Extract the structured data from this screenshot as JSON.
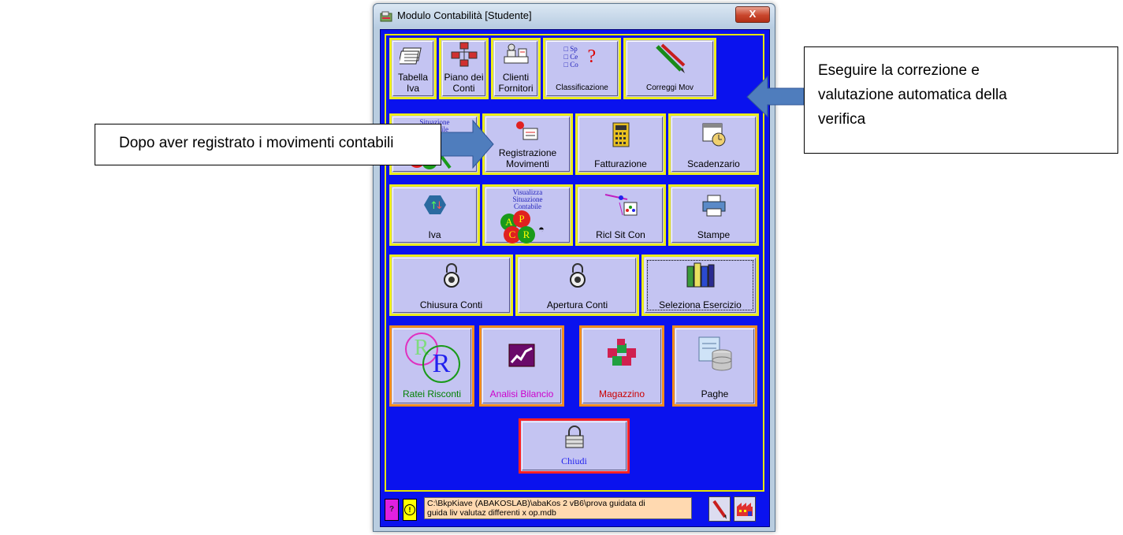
{
  "window": {
    "title": "Modulo Contabilità  [Studente]",
    "close_symbol": "X"
  },
  "row1": [
    {
      "label_lines": [
        "Tabella",
        "Iva"
      ],
      "icon": "ledger-icon"
    },
    {
      "label_lines": [
        "Piano dei",
        "Conti"
      ],
      "icon": "org-chart-icon"
    },
    {
      "label_lines": [
        "Clienti",
        "Fornitori"
      ],
      "icon": "person-desk-icon"
    },
    {
      "label_lines": [
        "Classificazione"
      ],
      "icon": "classification-icon",
      "icon_text": [
        "Sp",
        "Ce",
        "Co"
      ],
      "icon_mark": "?"
    },
    {
      "label_lines": [
        "Correggi Mov"
      ],
      "icon": "pencils-icon"
    }
  ],
  "row2": [
    {
      "label_lines": [
        ""
      ],
      "icon_text": [
        "Situazione",
        "Contabile"
      ],
      "icon": "account-situation-icon"
    },
    {
      "label_lines": [
        "Registrazione",
        "Movimenti"
      ],
      "icon": "registration-icon"
    },
    {
      "label_lines": [
        "Fatturazione"
      ],
      "icon": "calculator-icon"
    },
    {
      "label_lines": [
        "Scadenzario"
      ],
      "icon": "calendar-clock-icon"
    }
  ],
  "row3": [
    {
      "label_lines": [
        "Iva"
      ],
      "icon": "iva-arrows-icon"
    },
    {
      "label_lines": [
        ""
      ],
      "icon_text": [
        "Visualizza",
        "Situazione",
        "Contabile"
      ],
      "icon_letters": [
        "A",
        "P",
        "C",
        "R"
      ],
      "icon": "view-situation-icon"
    },
    {
      "label_lines": [
        "Ricl Sit Con"
      ],
      "icon": "reclassify-icon"
    },
    {
      "label_lines": [
        "Stampe"
      ],
      "icon": "printer-icon"
    }
  ],
  "row4": [
    {
      "label_lines": [
        "Chiusura Conti"
      ],
      "icon": "padlock-dial-icon"
    },
    {
      "label_lines": [
        "Apertura Conti"
      ],
      "icon": "padlock-dial-icon"
    },
    {
      "label_lines": [
        "Seleziona Esercizio"
      ],
      "icon": "books-icon"
    }
  ],
  "row5": [
    {
      "label": "Ratei Risconti",
      "label_color": "#008000",
      "icon": "ratei-risconti-icon",
      "icon_letters": [
        "R",
        "R"
      ]
    },
    {
      "label": "Analisi Bilancio",
      "label_color": "#cc00cc",
      "icon": "stock-chart-icon"
    },
    {
      "label": "Magazzino",
      "label_color": "#cc0000",
      "icon": "boxes-icon"
    },
    {
      "label": "Paghe",
      "label_color": "#000000",
      "icon": "database-icon"
    }
  ],
  "close_button": {
    "label": "Chiudi",
    "icon": "padlock-icon"
  },
  "statusbar": {
    "help_symbol": "?",
    "warning_symbol": "!",
    "path_lines": [
      "C:\\BkpKiave (ABAKOSLAB)\\abaKos 2 vB6\\prova guidata di",
      "guida liv valutaz differenti x op.mdb"
    ]
  },
  "callouts": {
    "left": "Dopo aver registrato i movimenti contabili",
    "right_lines": [
      "Eseguire la correzione e",
      "valutazione automatica della",
      "verifica"
    ]
  },
  "colors": {
    "client_bg": "#0a12ee",
    "button_face": "#c4c4f2",
    "yellow_border": "#ecec1e",
    "orange_border": "#f08c1e",
    "red_border": "#ff2222",
    "arrow": "#4f7dbd"
  }
}
